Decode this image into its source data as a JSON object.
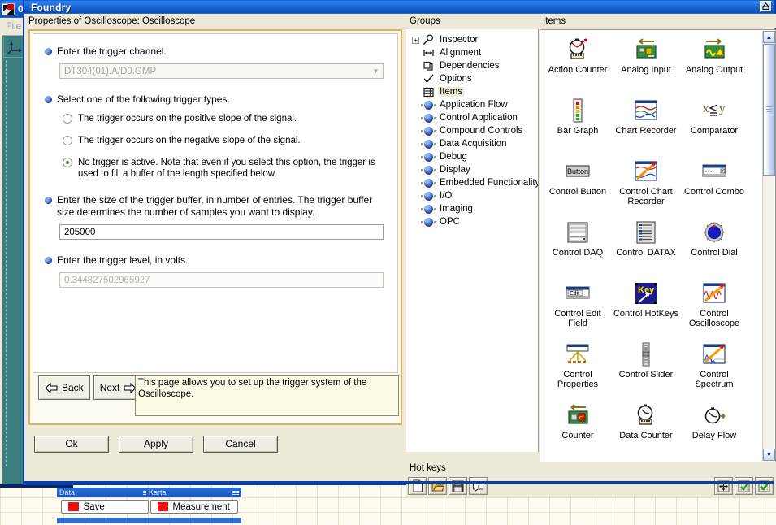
{
  "background_window": {
    "title": "0",
    "menu": "File",
    "app_icon": "checkered-flag-icon",
    "tool_icon": "axis-icon"
  },
  "window": {
    "title": "Foundry",
    "restore_button": "restore-icon"
  },
  "properties": {
    "header": "Properties of Oscilloscope: Oscilloscope",
    "q1": {
      "text": "Enter the trigger channel.",
      "channel_value": "DT304(01).A/D0.GMP",
      "dropdown_icon": "chevron-down-icon"
    },
    "q2": {
      "text": "Select one of the following trigger types.",
      "options": [
        {
          "label": "The trigger occurs on the positive slope of the signal.",
          "checked": false
        },
        {
          "label": "The trigger occurs on the negative slope of the signal.",
          "checked": false
        },
        {
          "label": "No trigger is active. Note that even if you select this option, the trigger is used to fill a buffer of the length specified below.",
          "checked": true
        }
      ]
    },
    "q3": {
      "text": "Enter the size of the trigger buffer, in number of entries. The trigger buffer size determines the number of samples you want to display.",
      "buffer_value": "205000"
    },
    "q4": {
      "text": "Enter the trigger level, in volts.",
      "level_value": "0.344827502965927"
    },
    "nav": {
      "back": "Back",
      "next": "Next",
      "back_icon": "arrow-left-icon",
      "next_icon": "arrow-right-icon"
    },
    "help_text": "This page allows you to set up the trigger system of the Oscilloscope.",
    "buttons": {
      "ok": "Ok",
      "apply": "Apply",
      "cancel": "Cancel"
    }
  },
  "groups": {
    "header": "Groups",
    "items": [
      {
        "label": "Inspector",
        "icon": "magnifier-icon",
        "expandable": true,
        "selected": false
      },
      {
        "label": "Alignment",
        "icon": "alignment-icon",
        "expandable": false,
        "selected": false
      },
      {
        "label": "Dependencies",
        "icon": "dependencies-icon",
        "expandable": false,
        "selected": false
      },
      {
        "label": "Options",
        "icon": "check-icon",
        "expandable": false,
        "selected": false
      },
      {
        "label": "Items",
        "icon": "grid-icon",
        "expandable": false,
        "selected": true
      },
      {
        "label": "Application Flow",
        "icon": "node-ball-icon",
        "expandable": false,
        "selected": false
      },
      {
        "label": "Control Application",
        "icon": "node-ball-icon",
        "expandable": false,
        "selected": false
      },
      {
        "label": "Compound Controls",
        "icon": "node-ball-icon",
        "expandable": false,
        "selected": false
      },
      {
        "label": "Data Acquisition",
        "icon": "node-ball-icon",
        "expandable": false,
        "selected": false
      },
      {
        "label": "Debug",
        "icon": "node-ball-icon",
        "expandable": false,
        "selected": false
      },
      {
        "label": "Display",
        "icon": "node-ball-icon",
        "expandable": false,
        "selected": false
      },
      {
        "label": "Embedded Functionality",
        "icon": "node-ball-icon",
        "expandable": false,
        "selected": false
      },
      {
        "label": "I/O",
        "icon": "node-ball-icon",
        "expandable": false,
        "selected": false
      },
      {
        "label": "Imaging",
        "icon": "node-ball-icon",
        "expandable": false,
        "selected": false
      },
      {
        "label": "OPC",
        "icon": "node-ball-icon",
        "expandable": false,
        "selected": false
      }
    ]
  },
  "items": {
    "header": "Items",
    "list": [
      {
        "label": "Action Counter",
        "icon": "stopwatch-counter-icon"
      },
      {
        "label": "Analog Input",
        "icon": "board-arrow-left-icon"
      },
      {
        "label": "Analog Output",
        "icon": "board-wave-arrow-right-icon"
      },
      {
        "label": "Bar Graph",
        "icon": "bargraph-icon"
      },
      {
        "label": "Chart Recorder",
        "icon": "chart-recorder-icon"
      },
      {
        "label": "Comparator",
        "icon": "comparator-icon"
      },
      {
        "label": "Control Button",
        "icon": "button-icon"
      },
      {
        "label": "Control Chart Recorder",
        "icon": "chart-arrow-icon"
      },
      {
        "label": "Control Combo",
        "icon": "combo-icon"
      },
      {
        "label": "Control DAQ",
        "icon": "daq-panel-icon"
      },
      {
        "label": "Control DATAX",
        "icon": "datax-list-icon"
      },
      {
        "label": "Control Dial",
        "icon": "dial-icon"
      },
      {
        "label": "Control Edit Field",
        "icon": "edit-field-icon"
      },
      {
        "label": "Control HotKeys",
        "icon": "key-icon"
      },
      {
        "label": "Control Oscilloscope",
        "icon": "oscilloscope-icon"
      },
      {
        "label": "Control Properties",
        "icon": "properties-tree-icon"
      },
      {
        "label": "Control Slider",
        "icon": "slider-icon"
      },
      {
        "label": "Control Spectrum",
        "icon": "spectrum-icon"
      },
      {
        "label": "Counter",
        "icon": "board-counter-icon"
      },
      {
        "label": "Data Counter",
        "icon": "stopwatch-digits-icon"
      },
      {
        "label": "Delay Flow",
        "icon": "stopwatch-arrow-icon"
      }
    ],
    "scrollbar": {
      "up_icon": "chevron-up-icon",
      "down_icon": "chevron-down-icon"
    }
  },
  "hot_keys": {
    "header": "Hot keys",
    "left_buttons": [
      {
        "icon": "new-file-icon"
      },
      {
        "icon": "open-folder-icon"
      },
      {
        "icon": "save-disk-icon"
      },
      {
        "icon": "help-question-icon"
      }
    ],
    "right_buttons": [
      {
        "icon": "move-resize-icon"
      },
      {
        "icon": "grid-check-icon"
      },
      {
        "icon": "grid-check-alt-icon"
      }
    ]
  },
  "taskbar": [
    {
      "title": "Data",
      "button": "Save",
      "swatch": "#ee1111",
      "menu_icon": "hamburger-icon"
    },
    {
      "title": "Karta",
      "button": "Measurement",
      "swatch": "#ee1111",
      "menu_icon": "hamburger-icon"
    }
  ],
  "colors": {
    "titlebar_blue": "#1c68da",
    "wizard_border": "#d8b25c",
    "help_bg": "#fdfbe5",
    "panel_bg": "#ece9d8",
    "teal_panel": "#3c7d80"
  }
}
